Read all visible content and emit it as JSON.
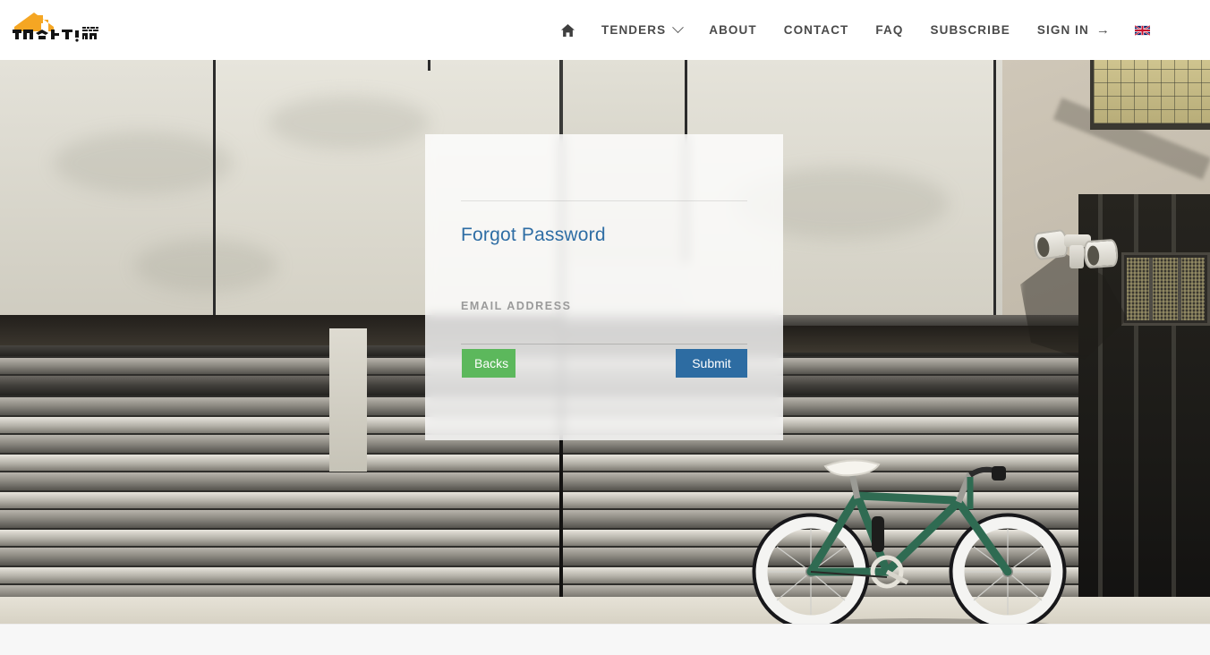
{
  "brand": {
    "name": "brand-logo",
    "text": "ምልክታ",
    "subtext": "የጨረታ ጣቢያ",
    "roof_color": "#f5a623",
    "text_color": "#1a1a1a"
  },
  "nav": {
    "home_icon": "home-icon",
    "items": [
      {
        "label": "TENDERS",
        "has_caret": true
      },
      {
        "label": "ABOUT",
        "has_caret": false
      },
      {
        "label": "CONTACT",
        "has_caret": false
      },
      {
        "label": "FAQ",
        "has_caret": false
      },
      {
        "label": "SUBSCRIBE",
        "has_caret": false
      },
      {
        "label": "SIGN IN",
        "has_caret": false,
        "arrow": "→"
      }
    ],
    "language_flag": "uk-flag-icon",
    "text_color": "#4a4a4a"
  },
  "card": {
    "title": "Forgot Password",
    "title_color": "#2e6da4",
    "email": {
      "label": "EMAIL ADDRESS",
      "value": "",
      "placeholder": ""
    },
    "buttons": {
      "back": {
        "label": "Backs",
        "color": "#5cb85c"
      },
      "submit": {
        "label": "Submit",
        "color": "#2d6ca2"
      }
    }
  },
  "hero": {
    "description": "photo-concrete-wall-with-green-bicycle",
    "bike_frame_color": "#2f6b52",
    "wall_color": "#d8d6cc"
  },
  "footer": {
    "background": "#f7f7f7"
  }
}
